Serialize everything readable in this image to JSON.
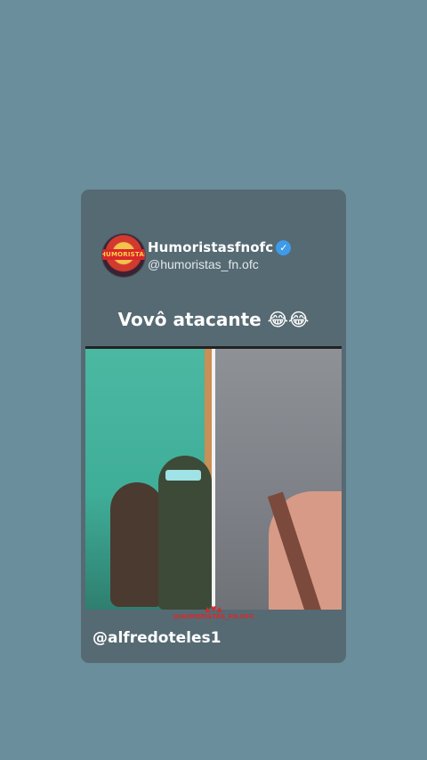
{
  "post": {
    "account_name": "Humoristasfnofc",
    "account_handle": "@humoristas_fn.ofc",
    "avatar_text": "HUMORISTAS",
    "verified_symbol": "✓",
    "caption": "Vovô atacante 😂😂",
    "watermark_icons": "▲♥▲",
    "watermark_text": "@HUMORISTAS_FN.OFC",
    "credit": "@alfredoteles1"
  },
  "colors": {
    "background": "#6a8e9b",
    "card": "#566a73",
    "verified_badge": "#3d9be9",
    "watermark": "#d32b2b"
  },
  "icons": {
    "verified": "verified-badge-icon"
  }
}
